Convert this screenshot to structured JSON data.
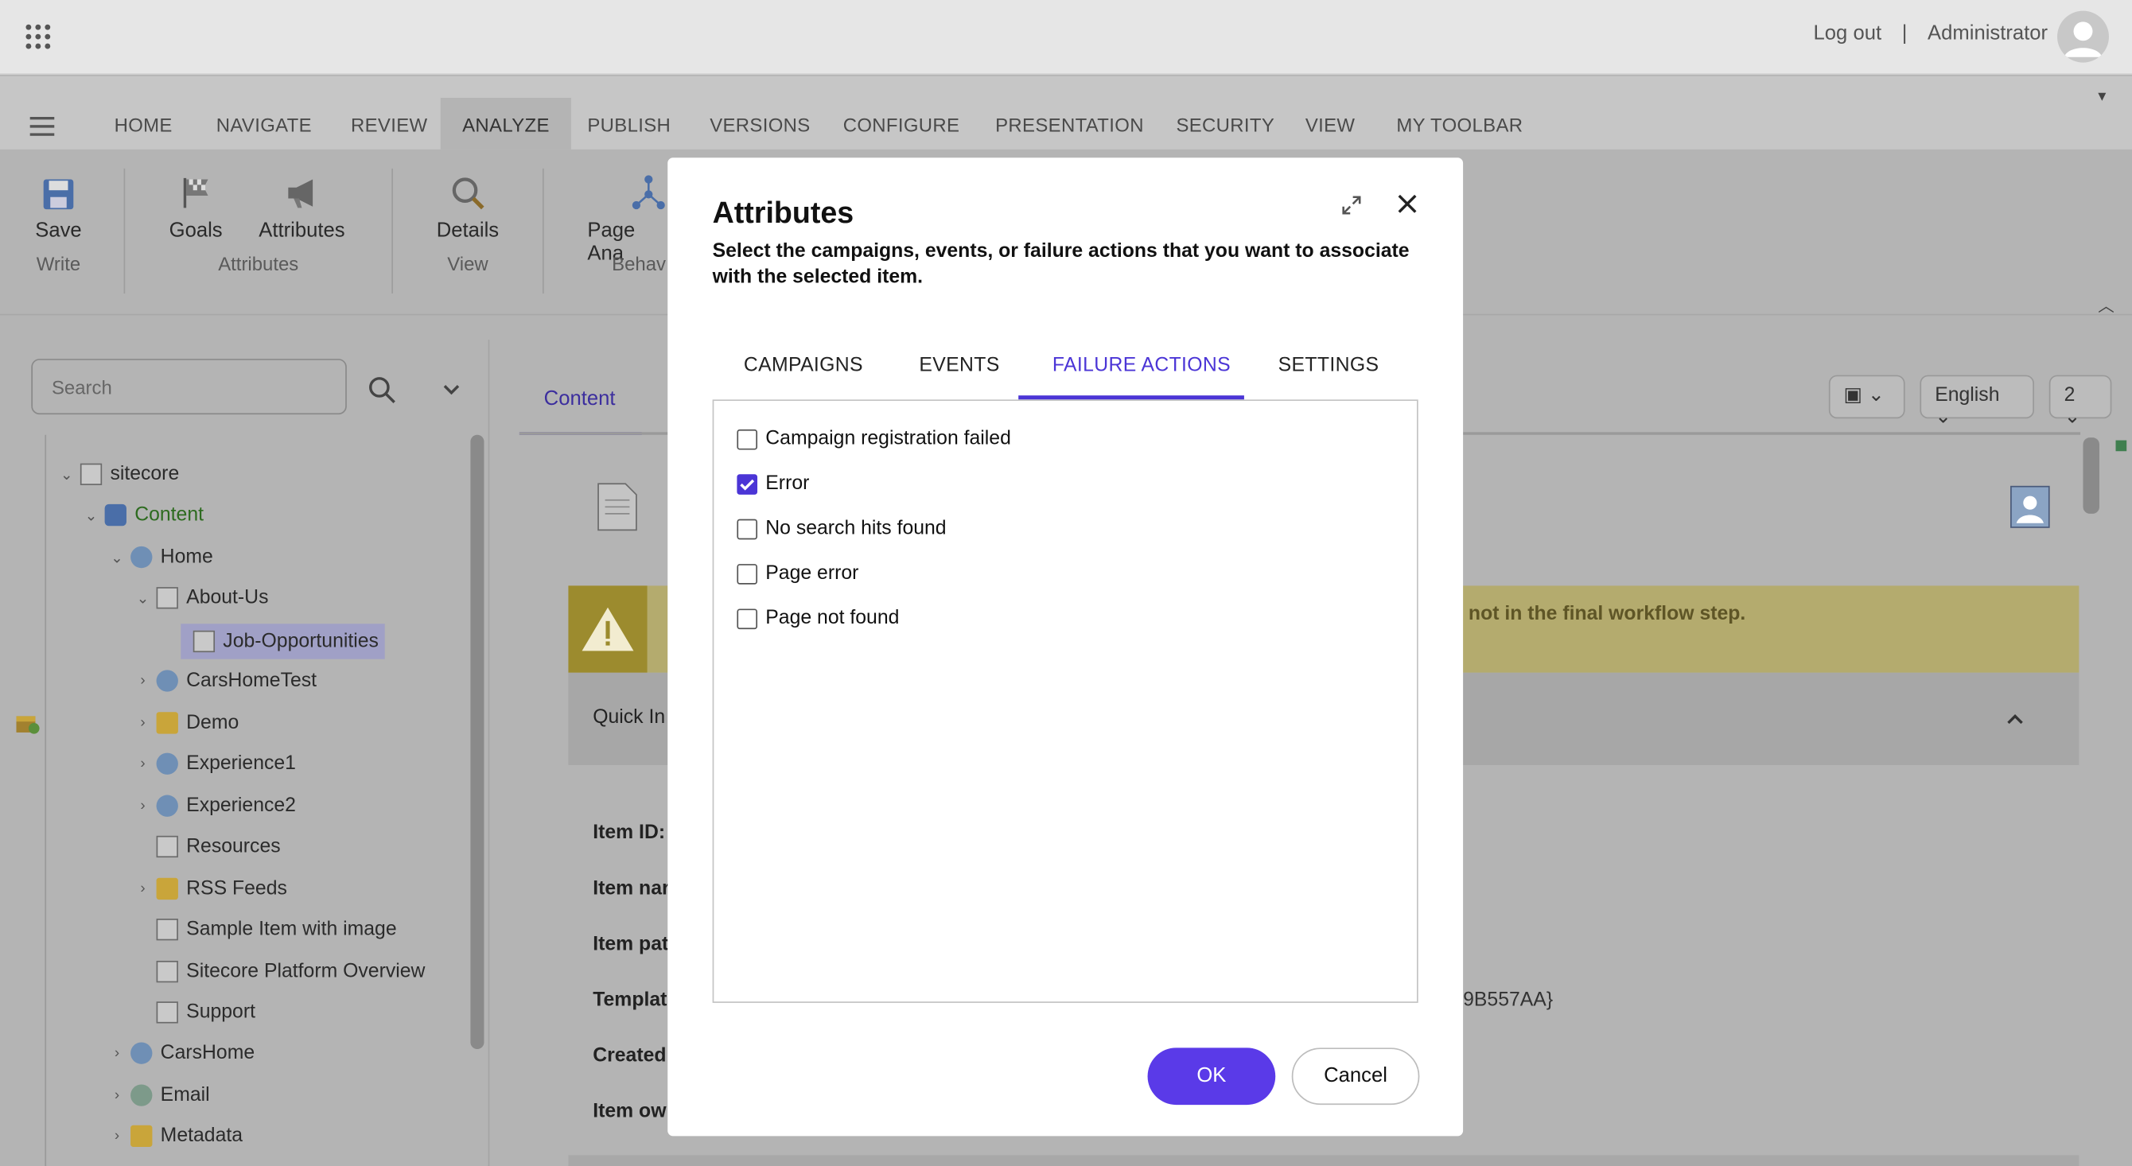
{
  "topbar": {
    "logout": "Log out",
    "separator": "|",
    "user": "Administrator"
  },
  "ribbon_tabs": [
    "HOME",
    "NAVIGATE",
    "REVIEW",
    "ANALYZE",
    "PUBLISH",
    "VERSIONS",
    "CONFIGURE",
    "PRESENTATION",
    "SECURITY",
    "VIEW",
    "MY TOOLBAR"
  ],
  "ribbon": {
    "save": "Save",
    "write": "Write",
    "goals": "Goals",
    "attributes": "Attributes",
    "attributes_group": "Attributes",
    "details": "Details",
    "view_group": "View",
    "page_analyzer": "Page Ana",
    "behavior_group": "Behav"
  },
  "search": {
    "placeholder": "Search"
  },
  "tree": {
    "sitecore": "sitecore",
    "content": "Content",
    "home": "Home",
    "about_us": "About-Us",
    "job_opportunities": "Job-Opportunities",
    "carshometest": "CarsHomeTest",
    "demo": "Demo",
    "experience1": "Experience1",
    "experience2": "Experience2",
    "resources": "Resources",
    "rss_feeds": "RSS Feeds",
    "sample_item": "Sample Item with image",
    "platform_overview": "Sitecore Platform Overview",
    "support": "Support",
    "carshome": "CarsHome",
    "email": "Email",
    "metadata": "Metadata"
  },
  "content": {
    "tab": "Content",
    "language": "English",
    "version": "2",
    "warning": "not in the final workflow step.",
    "quick_info": "Quick In",
    "fields": {
      "item_id": "Item ID:",
      "item_name": "Item nar",
      "item_path": "Item pat",
      "template": "Templat",
      "created": "Created",
      "item_owner": "Item ow"
    },
    "template_tail": "9B557AA}"
  },
  "dialog": {
    "title": "Attributes",
    "subtitle": "Select the campaigns, events, or failure actions that you want to associate with the selected item.",
    "tabs": [
      "CAMPAIGNS",
      "EVENTS",
      "FAILURE ACTIONS",
      "SETTINGS"
    ],
    "active_tab": "FAILURE ACTIONS",
    "options": [
      {
        "label": "Campaign registration failed",
        "checked": false
      },
      {
        "label": "Error",
        "checked": true
      },
      {
        "label": "No search hits found",
        "checked": false
      },
      {
        "label": "Page error",
        "checked": false
      },
      {
        "label": "Page not found",
        "checked": false
      }
    ],
    "ok": "OK",
    "cancel": "Cancel"
  },
  "colors": {
    "accent": "#5a3ae8",
    "tab_active": "#4b35d6",
    "warning_bg": "#b4ab6e"
  }
}
